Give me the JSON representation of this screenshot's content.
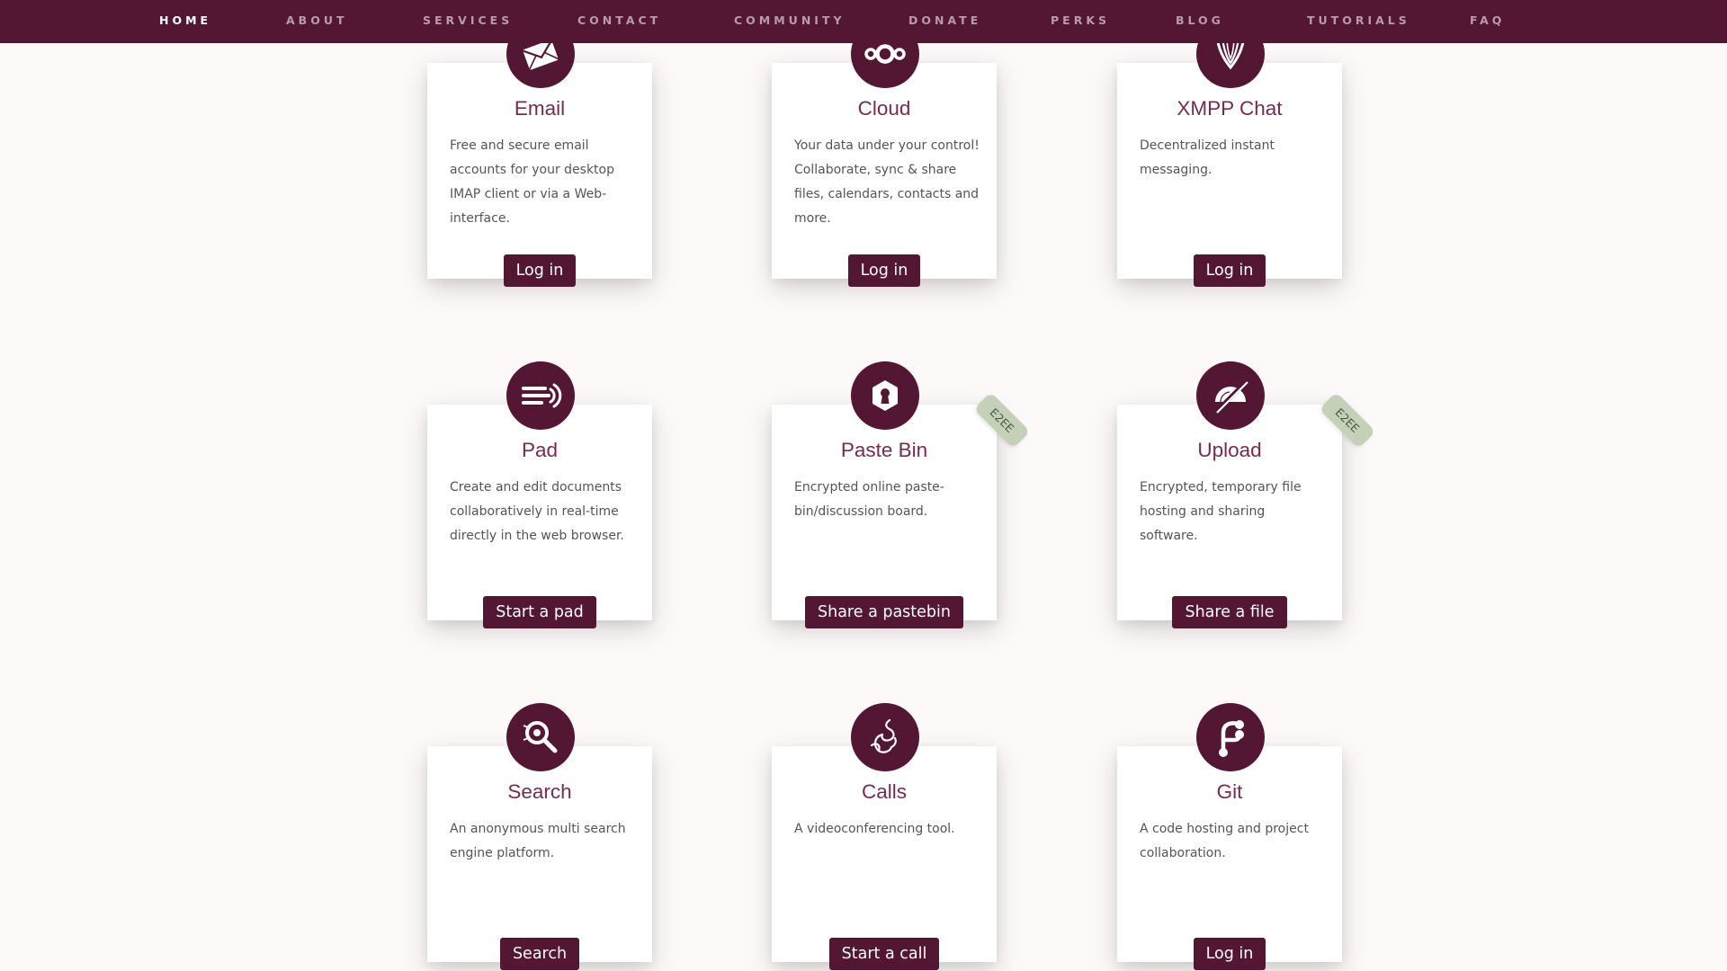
{
  "nav": {
    "items": [
      "HOME",
      "ABOUT",
      "SERVICES",
      "CONTACT",
      "COMMUNITY",
      "DONATE",
      "PERKS",
      "BLOG",
      "TUTORIALS",
      "FAQ"
    ],
    "active": "HOME"
  },
  "colors": {
    "brand": "#541733",
    "title": "#7a2a4f",
    "badge_bg": "#c4d1b8",
    "page_bg": "#fcf9f8"
  },
  "cards": [
    {
      "title": "Email",
      "desc": "Free and secure email accounts for your desktop IMAP client or via a Web-interface.",
      "button": "Log in",
      "icon": "envelope-icon"
    },
    {
      "title": "Cloud",
      "desc": "Your data under your control! Collaborate, sync & share files, calendars, contacts and more.",
      "button": "Log in",
      "icon": "nextcloud-icon"
    },
    {
      "title": "XMPP Chat",
      "desc": "Decentralized instant messaging.",
      "button": "Log in",
      "icon": "xmpp-icon"
    },
    {
      "title": "Pad",
      "desc": "Create and edit documents collaboratively in real-time directly in the web browser.",
      "button": "Start a pad",
      "icon": "etherpad-icon"
    },
    {
      "title": "Paste Bin",
      "desc": "Encrypted online paste-bin/discussion board.",
      "button": "Share a pastebin",
      "icon": "keyhole-icon",
      "badge": "E2EE"
    },
    {
      "title": "Upload",
      "desc": "Encrypted, temporary file hosting and sharing software.",
      "button": "Share a file",
      "icon": "lufi-icon",
      "badge": "E2EE"
    },
    {
      "title": "Search",
      "desc": "An anonymous multi search engine platform.",
      "button": "Search",
      "icon": "searx-icon"
    },
    {
      "title": "Calls",
      "desc": "A videoconferencing tool.",
      "button": "Start a call",
      "icon": "jitsi-icon"
    },
    {
      "title": "Git",
      "desc": "A code hosting and project collaboration.",
      "button": "Log in",
      "icon": "gitea-icon"
    }
  ]
}
